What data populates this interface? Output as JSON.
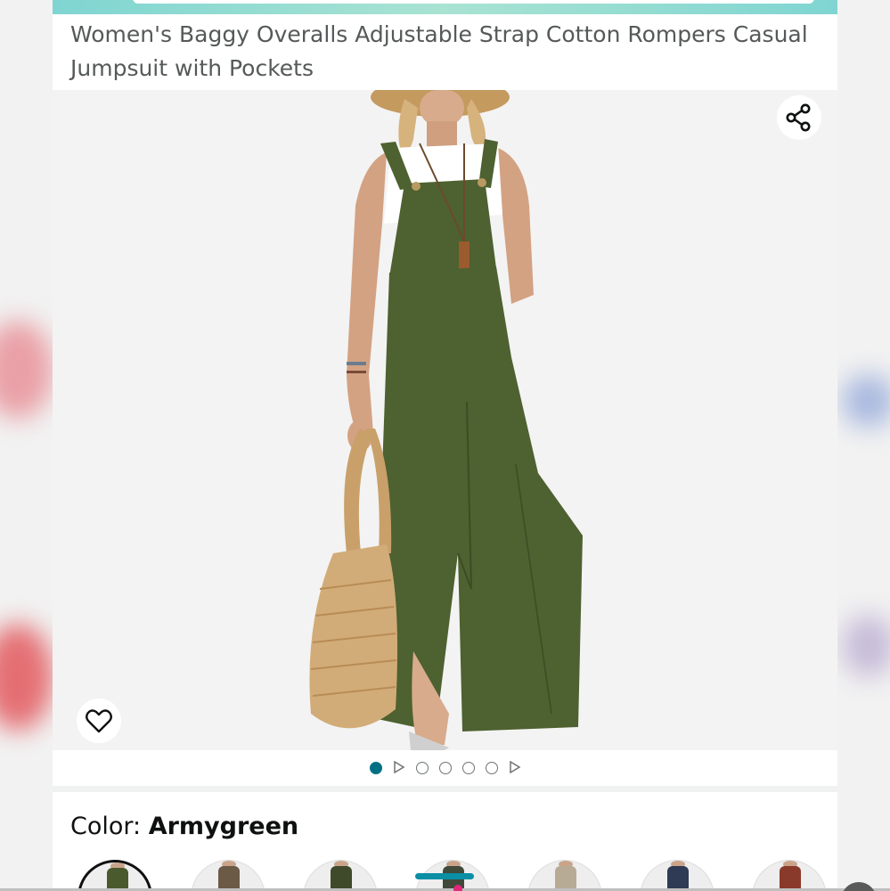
{
  "product": {
    "title": "Women's Baggy Overalls Adjustable Strap Cotton Rompers Casual Jumpsuit with Pockets"
  },
  "gallery": {
    "share_icon": "share-icon",
    "favorite_icon": "heart-icon",
    "indicators": [
      "dot-active",
      "video-play",
      "dot",
      "dot",
      "dot",
      "dot",
      "video-play"
    ]
  },
  "color": {
    "label": "Color:",
    "selected": "Armygreen",
    "swatch_colors": [
      "#4b5a2c",
      "#6b5a45",
      "#3f4a2a",
      "#404a3a",
      "#b7ab95",
      "#2f3a55",
      "#8a3a2a"
    ]
  },
  "colors": {
    "accent": "#007185",
    "title_text": "#565959",
    "product_green": "#4e6130"
  }
}
